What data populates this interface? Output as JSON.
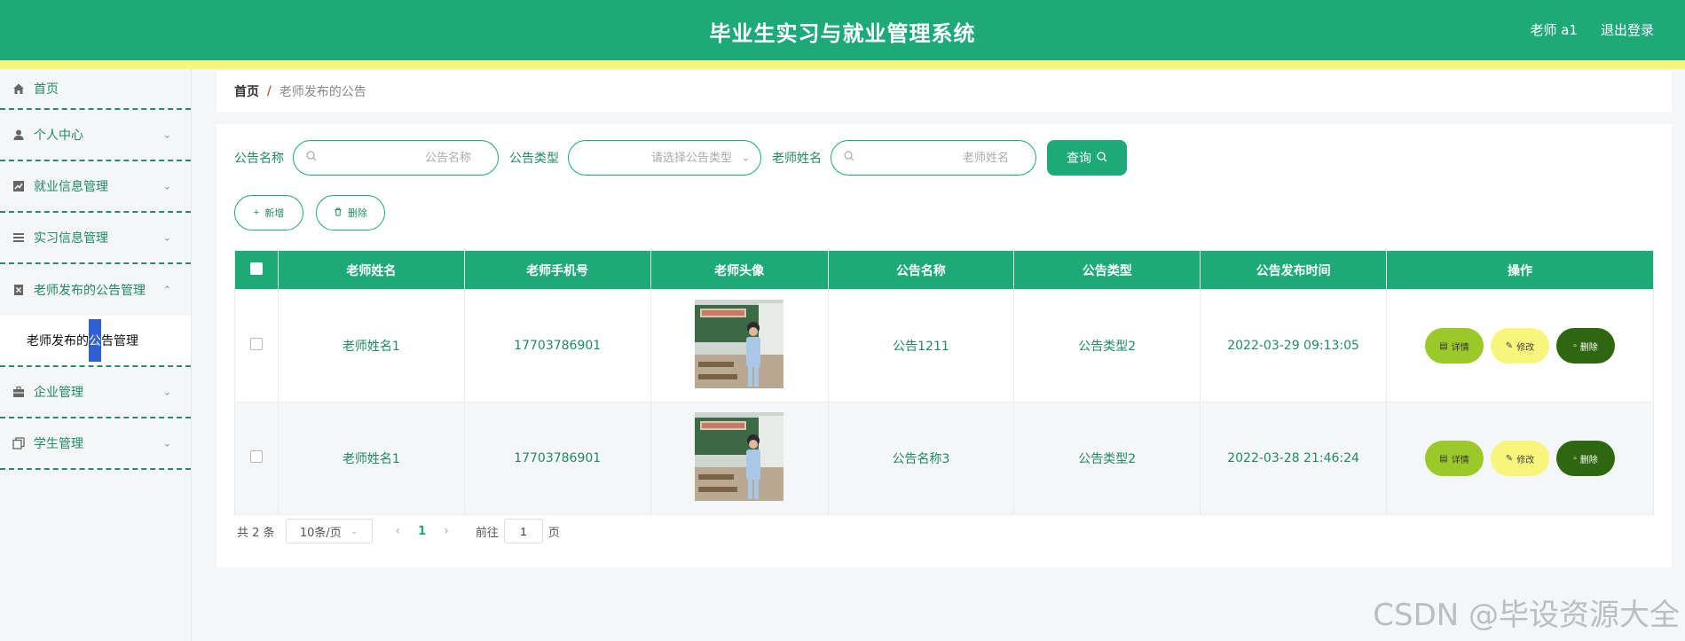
{
  "header": {
    "title": "毕业生实习与就业管理系统",
    "user_label": "老师 a1",
    "logout_label": "退出登录"
  },
  "sidebar": {
    "items": [
      {
        "label": "首页",
        "icon": "home-icon"
      },
      {
        "label": "个人中心",
        "icon": "user-icon"
      },
      {
        "label": "就业信息管理",
        "icon": "chart-icon"
      },
      {
        "label": "实习信息管理",
        "icon": "list-icon"
      },
      {
        "label": "老师发布的公告管理",
        "icon": "document-icon"
      },
      {
        "label": "企业管理",
        "icon": "briefcase-icon"
      },
      {
        "label": "学生管理",
        "icon": "copy-icon"
      }
    ],
    "sub_item_pre": "老师发布的",
    "sub_item_hl": "公",
    "sub_item_post": "告管理"
  },
  "breadcrumb": {
    "home": "首页",
    "separator": "/",
    "current": "老师发布的公告"
  },
  "search": {
    "name_label": "公告名称",
    "name_placeholder": "公告名称",
    "type_label": "公告类型",
    "type_placeholder": "请选择公告类型",
    "teacher_label": "老师姓名",
    "teacher_placeholder": "老师姓名",
    "query_label": "查询"
  },
  "actions": {
    "add_label": "新增",
    "delete_label": "删除"
  },
  "table": {
    "headers": [
      "老师姓名",
      "老师手机号",
      "老师头像",
      "公告名称",
      "公告类型",
      "公告发布时间",
      "操作"
    ],
    "rows": [
      {
        "teacher": "老师姓名1",
        "phone": "17703786901",
        "title": "公告1211",
        "type": "公告类型2",
        "time": "2022-03-29 09:13:05"
      },
      {
        "teacher": "老师姓名1",
        "phone": "17703786901",
        "title": "公告名称3",
        "type": "公告类型2",
        "time": "2022-03-28 21:46:24"
      }
    ],
    "op_detail": "详情",
    "op_edit": "修改",
    "op_delete": "删除"
  },
  "pagination": {
    "total": "共 2 条",
    "page_size": "10条/页",
    "current_page": "1",
    "goto_label": "前往",
    "goto_value": "1",
    "page_suffix": "页"
  },
  "watermark": "CSDN @毕设资源大全",
  "colors": {
    "primary": "#1eaa78",
    "stripe": "#f7f57a",
    "detail": "#9cc92a",
    "edit": "#f7f57a",
    "delete": "#2f6610"
  }
}
